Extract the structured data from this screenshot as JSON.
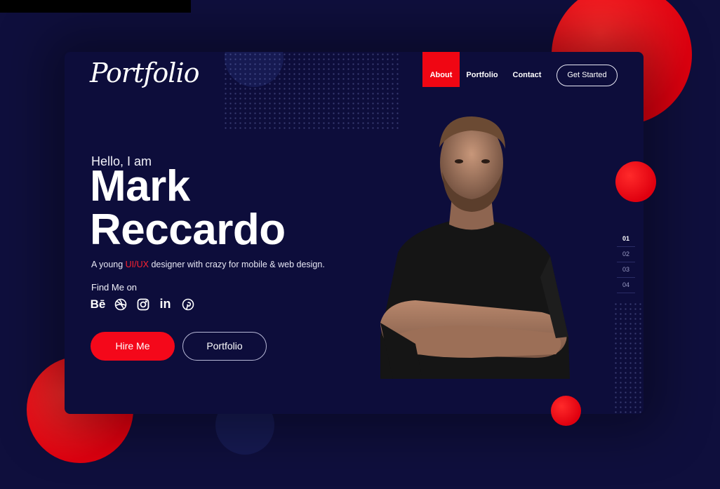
{
  "header": {
    "logo_text": "Portfolio",
    "nav": [
      {
        "label": "About",
        "active": true
      },
      {
        "label": "Portfolio",
        "active": false
      },
      {
        "label": "Contact",
        "active": false
      }
    ],
    "cta_label": "Get Started"
  },
  "hero": {
    "greeting": "Hello, I am",
    "first_name": "Mark",
    "last_name": "Reccardo",
    "tagline_prefix": "A young ",
    "tagline_accent": "UI/UX",
    "tagline_suffix": " designer with crazy for mobile & web design.",
    "find_me_label": "Find Me on",
    "socials": [
      "behance-icon",
      "dribbble-icon",
      "instagram-icon",
      "linkedin-icon",
      "pinterest-icon"
    ],
    "behance_text": "Bē",
    "linkedin_text": "in",
    "hire_label": "Hire Me",
    "portfolio_label": "Portfolio"
  },
  "pager": [
    "01",
    "02",
    "03",
    "04"
  ],
  "colors": {
    "background": "#0f0f3d",
    "card": "#0d0d3b",
    "accent": "#f00613"
  }
}
